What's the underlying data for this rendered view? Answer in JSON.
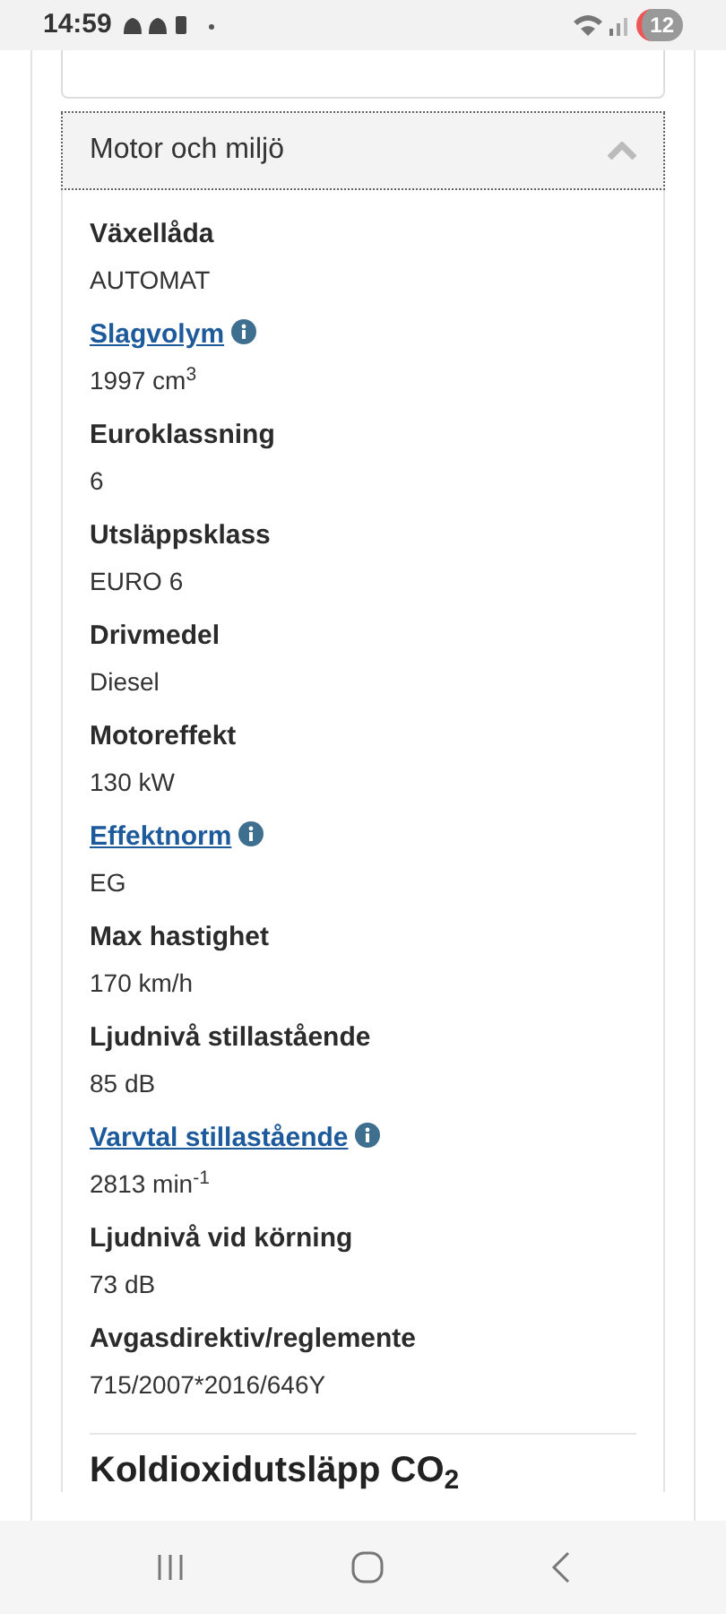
{
  "status_bar": {
    "time": "14:59",
    "notification_count": "12"
  },
  "section": {
    "title": "Motor och miljö",
    "expanded": true,
    "items": [
      {
        "label": "Växellåda",
        "value": "AUTOMAT",
        "kind": "plain"
      },
      {
        "label": "Slagvolym",
        "value": "1997 cm$^{3}$",
        "kind": "link"
      },
      {
        "label": "Euroklassning",
        "value": "6",
        "kind": "plain"
      },
      {
        "label": "Utsläppsklass",
        "value": "EURO 6",
        "kind": "plain"
      },
      {
        "label": "Drivmedel",
        "value": "Diesel",
        "kind": "plain"
      },
      {
        "label": "Motoreffekt",
        "value": "130 kW",
        "kind": "plain"
      },
      {
        "label": "Effektnorm",
        "value": "EG",
        "kind": "link"
      },
      {
        "label": "Max hastighet",
        "value": "170 km/h",
        "kind": "plain"
      },
      {
        "label": "Ljudnivå stillastående",
        "value": "85 dB",
        "kind": "plain"
      },
      {
        "label": "Varvtal stillastående",
        "value": "2813 min$^{-1}$",
        "kind": "link"
      },
      {
        "label": "Ljudnivå vid körning",
        "value": "73 dB",
        "kind": "plain"
      },
      {
        "label": "Avgasdirektiv/reglemente",
        "value": "715/2007*2016/646Y",
        "kind": "plain"
      }
    ]
  },
  "next_heading": "Koldioxidutsläpp CO$_{2}$"
}
